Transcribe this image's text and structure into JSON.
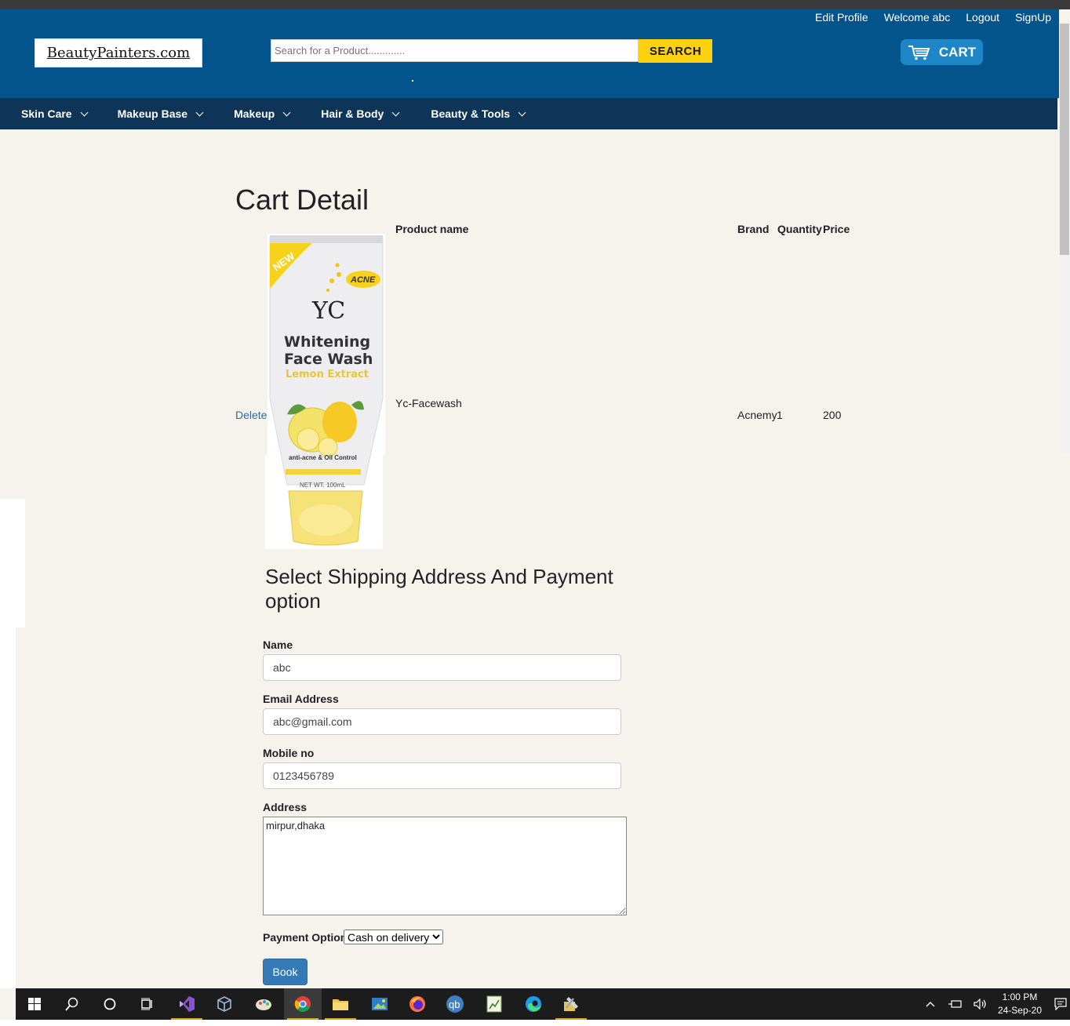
{
  "header": {
    "links": [
      "Edit Profile",
      "Welcome abc",
      "Logout",
      "SignUp"
    ],
    "logo_text": "BeautyPainters.com",
    "search_placeholder": "Search for a Product.............",
    "search_button": "SEARCH",
    "cart_label": "CART"
  },
  "nav": {
    "items": [
      "Skin Care",
      "Makeup Base",
      "Makeup",
      "Hair & Body",
      "Beauty & Tools"
    ]
  },
  "cart": {
    "title": "Cart Detail",
    "columns": {
      "product": "Product name",
      "brand": "Brand",
      "quantity": "Quantity",
      "price": "Price"
    },
    "row": {
      "action": "Delete",
      "product_name": "Yc-Facewash",
      "brand": "Acnemy",
      "quantity": "1",
      "price": "200"
    },
    "product_image_text": {
      "badge_new": "NEW",
      "badge_acne": "ACNE",
      "brand_mark": "YC",
      "line1": "Whitening",
      "line2": "Face Wash",
      "line3": "Lemon Extract",
      "line4": "anti-acne & Oil Control",
      "line5": "NET WT. 100mL"
    }
  },
  "form": {
    "title": "Select Shipping Address And Payment option",
    "name_label": "Name",
    "name_value": "abc",
    "email_label": "Email Address",
    "email_value": "abc@gmail.com",
    "mobile_label": "Mobile no",
    "mobile_value": "0123456789",
    "address_label": "Address",
    "address_value": "mirpur,dhaka",
    "payment_label": "Payment Option",
    "payment_selected": "Cash on delivery",
    "book_button": "Book"
  },
  "taskbar": {
    "time": "1:00 PM",
    "date": "24-Sep-20"
  },
  "colors": {
    "header_bg": "#03538c",
    "nav_bg": "#0e3557",
    "search_button": "#fcd10f",
    "cart_button": "#1e86c6",
    "book_button": "#337ab7",
    "page_bg": "#f6f3ed"
  }
}
